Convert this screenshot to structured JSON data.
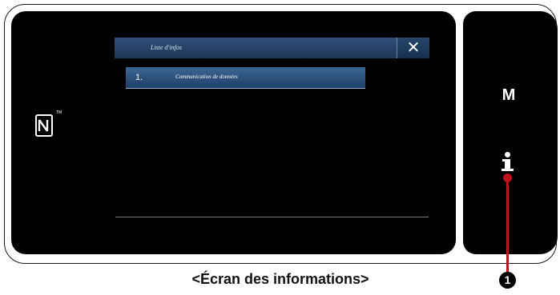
{
  "window": {
    "title": "Liste d'infos",
    "close_symbol": "✕"
  },
  "list": {
    "items": [
      {
        "number": "1.",
        "label": "Communication de données"
      }
    ]
  },
  "side_panel": {
    "mode_button_label": "M",
    "info_icon": "info-icon"
  },
  "nfc": {
    "icon": "nfc-icon",
    "trademark": "TM"
  },
  "callout": {
    "number": "1"
  },
  "caption": "<Écran des informations>",
  "colors": {
    "title_bar": "#1d3757",
    "list_button": "#2f5784",
    "callout": "#c0121c"
  }
}
